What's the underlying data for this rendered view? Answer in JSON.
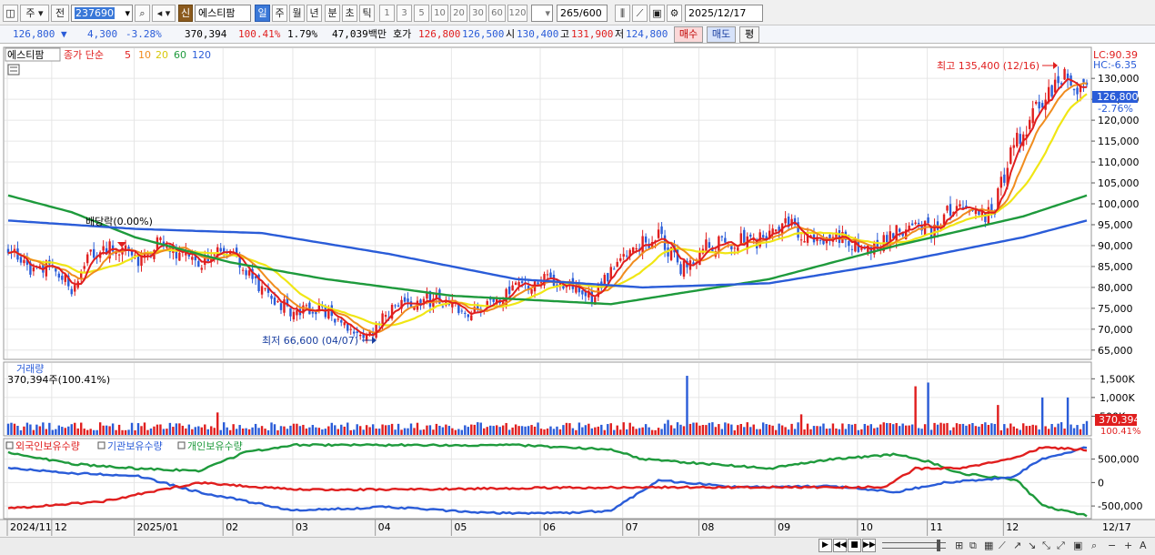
{
  "toolbar": {
    "period_label": "주",
    "prev_label": "전",
    "code_value": "237690",
    "new_badge": "신",
    "stock_name": "에스티팜",
    "period_tabs": [
      "일",
      "주",
      "월",
      "년",
      "분",
      "초",
      "틱"
    ],
    "minute_options": [
      "1",
      "3",
      "5",
      "10",
      "20",
      "30",
      "60",
      "120"
    ],
    "count_value": "265",
    "count_total": "/600",
    "date_value": "2025/12/17"
  },
  "quote": {
    "price": "126,800",
    "change": "4,300",
    "change_pct": "-3.28%",
    "volume": "370,394",
    "volume_ratio": "100.41%",
    "turnover_pct": "1.79%",
    "amount": "47,039백만",
    "bid_ask_label": "호가",
    "ask_price": "126,800",
    "bid_price": "126,500",
    "open_label": "시",
    "open": "130,400",
    "high_label": "고",
    "high": "131,900",
    "low_label": "저",
    "low": "124,800",
    "buy_label": "매수",
    "sell_label": "매도",
    "eval_label": "평"
  },
  "price_panel": {
    "legend_name": "에스티팜",
    "legend_ma_label": "종가 단순",
    "ma_periods": [
      "5",
      "10",
      "20",
      "60",
      "120"
    ],
    "ma_colors": [
      "#e01e1e",
      "#f08c1e",
      "#f0e614",
      "#1e9a3c",
      "#2a5cd8"
    ],
    "lc_text": "LC:90.39",
    "hc_text": "HC:-6.35",
    "high_note": "최고 135,400 (12/16)",
    "low_note": "최저 66,600 (04/07)",
    "dividend_note": "배당락(0.00%)",
    "current_price_label": "126,800",
    "current_change_label": "-2.76%",
    "y_ticks": [
      "130,000",
      "125,000",
      "120,000",
      "115,000",
      "110,000",
      "105,000",
      "100,000",
      "95,000",
      "90,000",
      "85,000",
      "80,000",
      "75,000",
      "70,000",
      "65,000"
    ]
  },
  "volume_panel": {
    "title": "거래량",
    "value_text": "370,394주(100.41%)",
    "y_ticks": [
      "1,500K",
      "1,000K",
      "500K"
    ],
    "current_label": "370,394",
    "current_pct": "100.41%"
  },
  "holding_panel": {
    "legend": [
      "외국인보유수량",
      "기관보유수량",
      "개인보유수량"
    ],
    "legend_colors": [
      "#e01e1e",
      "#2a5cd8",
      "#1e9a3c"
    ],
    "y_ticks": [
      "500,000",
      "0",
      "-500,000"
    ]
  },
  "time_axis": {
    "labels": [
      "2024/11",
      "12",
      "2025/01",
      "02",
      "03",
      "04",
      "05",
      "06",
      "07",
      "08",
      "09",
      "10",
      "11",
      "12"
    ],
    "right_label": "12/17"
  },
  "colors": {
    "up": "#e01e1e",
    "down": "#2a5cd8",
    "grid": "#e6e6e6",
    "current_price_bg": "#2a5cd8",
    "current_volume_bg": "#e01e1e"
  },
  "chart_data": {
    "type": "candlestick",
    "period": "daily",
    "x_range": [
      "2024-11",
      "2025-12-17"
    ],
    "price_ylim": [
      63000,
      137000
    ],
    "price_anchors": [
      [
        0,
        90000
      ],
      [
        8,
        84000
      ],
      [
        14,
        86000
      ],
      [
        20,
        80000
      ],
      [
        26,
        88000
      ],
      [
        34,
        90000
      ],
      [
        42,
        86000
      ],
      [
        48,
        91000
      ],
      [
        55,
        88000
      ],
      [
        62,
        86000
      ],
      [
        68,
        90000
      ],
      [
        74,
        84000
      ],
      [
        82,
        78000
      ],
      [
        90,
        74000
      ],
      [
        98,
        75000
      ],
      [
        106,
        71000
      ],
      [
        113,
        68000
      ],
      [
        120,
        74000
      ],
      [
        128,
        77000
      ],
      [
        136,
        77000
      ],
      [
        144,
        74000
      ],
      [
        152,
        76000
      ],
      [
        160,
        80000
      ],
      [
        168,
        82000
      ],
      [
        176,
        80000
      ],
      [
        184,
        78000
      ],
      [
        192,
        86000
      ],
      [
        200,
        91000
      ],
      [
        206,
        92000
      ],
      [
        212,
        84000
      ],
      [
        220,
        90000
      ],
      [
        228,
        91000
      ],
      [
        236,
        91000
      ],
      [
        244,
        96000
      ],
      [
        252,
        92000
      ],
      [
        260,
        92000
      ],
      [
        268,
        90000
      ],
      [
        274,
        90000
      ],
      [
        280,
        93000
      ],
      [
        286,
        95000
      ],
      [
        292,
        93000
      ],
      [
        298,
        100000
      ],
      [
        304,
        98000
      ],
      [
        310,
        97000
      ],
      [
        316,
        112000
      ],
      [
        322,
        120000
      ],
      [
        328,
        128000
      ],
      [
        334,
        130000
      ],
      [
        340,
        126800
      ]
    ],
    "ma_anchors": {
      "60": [
        [
          0,
          102000
        ],
        [
          20,
          98000
        ],
        [
          40,
          92000
        ],
        [
          70,
          86000
        ],
        [
          100,
          82000
        ],
        [
          140,
          78000
        ],
        [
          190,
          76000
        ],
        [
          240,
          82000
        ],
        [
          280,
          90000
        ],
        [
          320,
          97000
        ],
        [
          340,
          102000
        ]
      ],
      "120": [
        [
          0,
          96000
        ],
        [
          40,
          94000
        ],
        [
          80,
          93000
        ],
        [
          120,
          88000
        ],
        [
          160,
          82000
        ],
        [
          200,
          80000
        ],
        [
          240,
          81000
        ],
        [
          280,
          86000
        ],
        [
          320,
          92000
        ],
        [
          340,
          96000
        ]
      ]
    },
    "volume_ylim": [
      0,
      1800
    ],
    "volume_spikes_k": [
      [
        66,
        600
      ],
      [
        208,
        400
      ],
      [
        214,
        1580
      ],
      [
        250,
        550
      ],
      [
        286,
        1300
      ],
      [
        290,
        1400
      ],
      [
        312,
        800
      ],
      [
        326,
        1000
      ],
      [
        334,
        1000
      ],
      [
        340,
        370
      ]
    ],
    "holding_ylim": [
      -750000,
      900000
    ],
    "foreign_anchors": [
      [
        0,
        -550000
      ],
      [
        30,
        -400000
      ],
      [
        60,
        0
      ],
      [
        90,
        -150000
      ],
      [
        120,
        -150000
      ],
      [
        160,
        -120000
      ],
      [
        200,
        -100000
      ],
      [
        240,
        -100000
      ],
      [
        276,
        -100000
      ],
      [
        286,
        300000
      ],
      [
        300,
        300000
      ],
      [
        316,
        500000
      ],
      [
        326,
        750000
      ],
      [
        340,
        700000
      ]
    ],
    "institution_anchors": [
      [
        0,
        300000
      ],
      [
        20,
        200000
      ],
      [
        40,
        150000
      ],
      [
        60,
        -200000
      ],
      [
        90,
        -600000
      ],
      [
        120,
        -520000
      ],
      [
        150,
        -650000
      ],
      [
        175,
        -650000
      ],
      [
        190,
        -600000
      ],
      [
        205,
        50000
      ],
      [
        230,
        -100000
      ],
      [
        260,
        -80000
      ],
      [
        280,
        -200000
      ],
      [
        295,
        0
      ],
      [
        316,
        100000
      ],
      [
        326,
        500000
      ],
      [
        340,
        750000
      ]
    ],
    "individual_anchors": [
      [
        0,
        650000
      ],
      [
        20,
        400000
      ],
      [
        40,
        300000
      ],
      [
        60,
        250000
      ],
      [
        75,
        650000
      ],
      [
        90,
        800000
      ],
      [
        120,
        800000
      ],
      [
        160,
        800000
      ],
      [
        190,
        700000
      ],
      [
        200,
        500000
      ],
      [
        240,
        300000
      ],
      [
        260,
        500000
      ],
      [
        280,
        600000
      ],
      [
        290,
        450000
      ],
      [
        300,
        200000
      ],
      [
        318,
        50000
      ],
      [
        326,
        -500000
      ],
      [
        340,
        -700000
      ]
    ]
  }
}
